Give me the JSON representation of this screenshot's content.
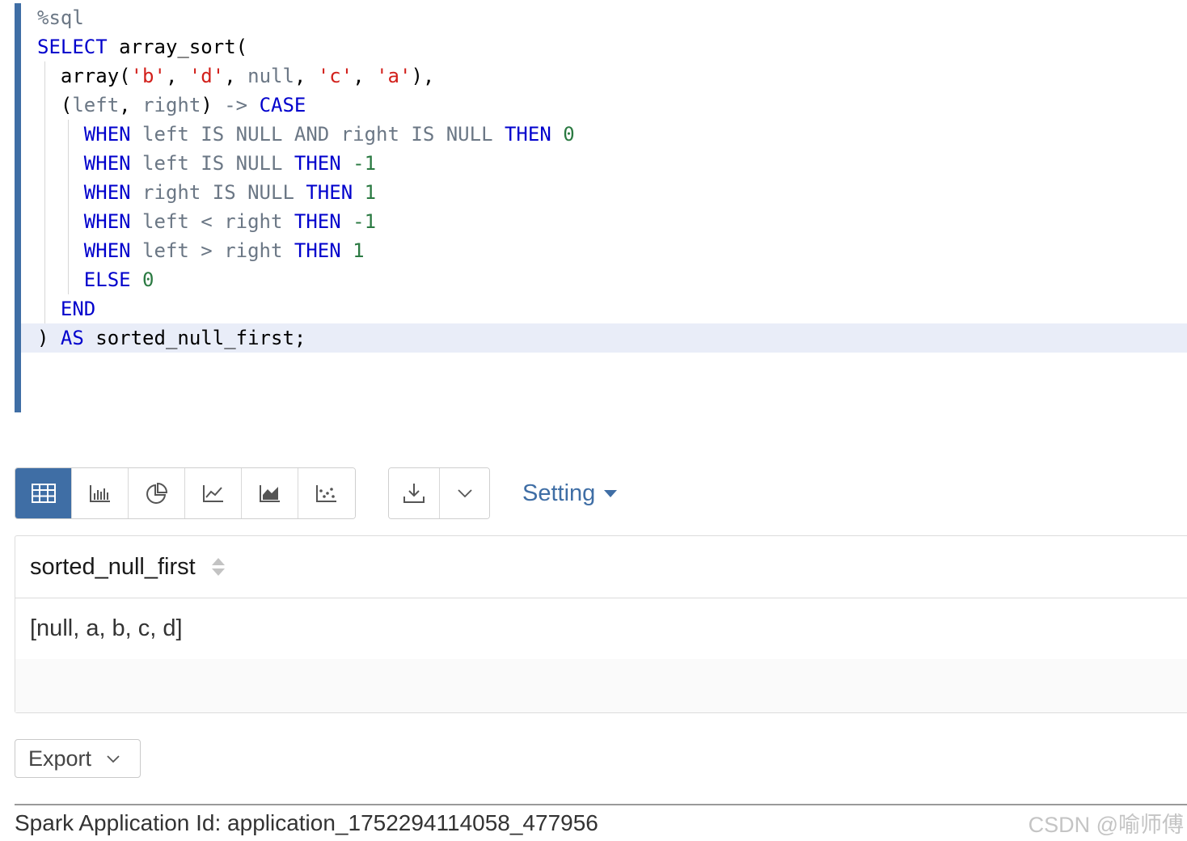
{
  "editor": {
    "magic": "%sql",
    "lines": [
      [
        {
          "c": "magic",
          "t": "%sql"
        }
      ],
      [
        {
          "c": "kw",
          "t": "SELECT"
        },
        {
          "c": "",
          "t": " array_sort("
        }
      ],
      [
        {
          "c": "",
          "t": "  array("
        },
        {
          "c": "str",
          "t": "'b'"
        },
        {
          "c": "",
          "t": ", "
        },
        {
          "c": "str",
          "t": "'d'"
        },
        {
          "c": "",
          "t": ", "
        },
        {
          "c": "dim",
          "t": "null"
        },
        {
          "c": "",
          "t": ", "
        },
        {
          "c": "str",
          "t": "'c'"
        },
        {
          "c": "",
          "t": ", "
        },
        {
          "c": "str",
          "t": "'a'"
        },
        {
          "c": "",
          "t": "),"
        }
      ],
      [
        {
          "c": "",
          "t": "  ("
        },
        {
          "c": "dim",
          "t": "left"
        },
        {
          "c": "",
          "t": ", "
        },
        {
          "c": "dim",
          "t": "right"
        },
        {
          "c": "",
          "t": ") "
        },
        {
          "c": "dim",
          "t": "->"
        },
        {
          "c": "",
          "t": " "
        },
        {
          "c": "kw",
          "t": "CASE"
        }
      ],
      [
        {
          "c": "",
          "t": "    "
        },
        {
          "c": "kw",
          "t": "WHEN"
        },
        {
          "c": "",
          "t": " "
        },
        {
          "c": "dim",
          "t": "left IS NULL AND right IS NULL"
        },
        {
          "c": "",
          "t": " "
        },
        {
          "c": "kw",
          "t": "THEN"
        },
        {
          "c": "",
          "t": " "
        },
        {
          "c": "num",
          "t": "0"
        }
      ],
      [
        {
          "c": "",
          "t": "    "
        },
        {
          "c": "kw",
          "t": "WHEN"
        },
        {
          "c": "",
          "t": " "
        },
        {
          "c": "dim",
          "t": "left IS NULL"
        },
        {
          "c": "",
          "t": " "
        },
        {
          "c": "kw",
          "t": "THEN"
        },
        {
          "c": "",
          "t": " "
        },
        {
          "c": "num",
          "t": "-1"
        }
      ],
      [
        {
          "c": "",
          "t": "    "
        },
        {
          "c": "kw",
          "t": "WHEN"
        },
        {
          "c": "",
          "t": " "
        },
        {
          "c": "dim",
          "t": "right IS NULL"
        },
        {
          "c": "",
          "t": " "
        },
        {
          "c": "kw",
          "t": "THEN"
        },
        {
          "c": "",
          "t": " "
        },
        {
          "c": "num",
          "t": "1"
        }
      ],
      [
        {
          "c": "",
          "t": "    "
        },
        {
          "c": "kw",
          "t": "WHEN"
        },
        {
          "c": "",
          "t": " "
        },
        {
          "c": "dim",
          "t": "left < right"
        },
        {
          "c": "",
          "t": " "
        },
        {
          "c": "kw",
          "t": "THEN"
        },
        {
          "c": "",
          "t": " "
        },
        {
          "c": "num",
          "t": "-1"
        }
      ],
      [
        {
          "c": "",
          "t": "    "
        },
        {
          "c": "kw",
          "t": "WHEN"
        },
        {
          "c": "",
          "t": " "
        },
        {
          "c": "dim",
          "t": "left > right"
        },
        {
          "c": "",
          "t": " "
        },
        {
          "c": "kw",
          "t": "THEN"
        },
        {
          "c": "",
          "t": " "
        },
        {
          "c": "num",
          "t": "1"
        }
      ],
      [
        {
          "c": "",
          "t": "    "
        },
        {
          "c": "kw",
          "t": "ELSE"
        },
        {
          "c": "",
          "t": " "
        },
        {
          "c": "num",
          "t": "0"
        }
      ],
      [
        {
          "c": "",
          "t": "  "
        },
        {
          "c": "kw",
          "t": "END"
        }
      ],
      [
        {
          "c": "",
          "t": ") "
        },
        {
          "c": "kw",
          "t": "AS"
        },
        {
          "c": "",
          "t": " sorted_null_first;"
        }
      ]
    ],
    "active_line": 11
  },
  "toolbar": {
    "vis_buttons": [
      {
        "icon": "table-icon",
        "active": true
      },
      {
        "icon": "bar-chart-icon",
        "active": false
      },
      {
        "icon": "pie-chart-icon",
        "active": false
      },
      {
        "icon": "line-chart-icon",
        "active": false
      },
      {
        "icon": "area-chart-icon",
        "active": false
      },
      {
        "icon": "scatter-chart-icon",
        "active": false
      }
    ],
    "download_icon": "download-icon",
    "dropdown_icon": "chevron-down-icon",
    "setting_label": "Setting"
  },
  "table": {
    "column": "sorted_null_first",
    "rows": [
      "[null, a, b, c, d]"
    ]
  },
  "export": {
    "label": "Export"
  },
  "footer": {
    "app_id_text": "Spark Application Id: application_1752294114058_477956",
    "watermark": "CSDN @喻师傅"
  },
  "colors": {
    "accent": "#3f6ea5",
    "keyword": "#0000cc",
    "string": "#d2201b",
    "number": "#2b7a42",
    "identifier_dim": "#6b7785",
    "active_line": "#e9edf8"
  }
}
